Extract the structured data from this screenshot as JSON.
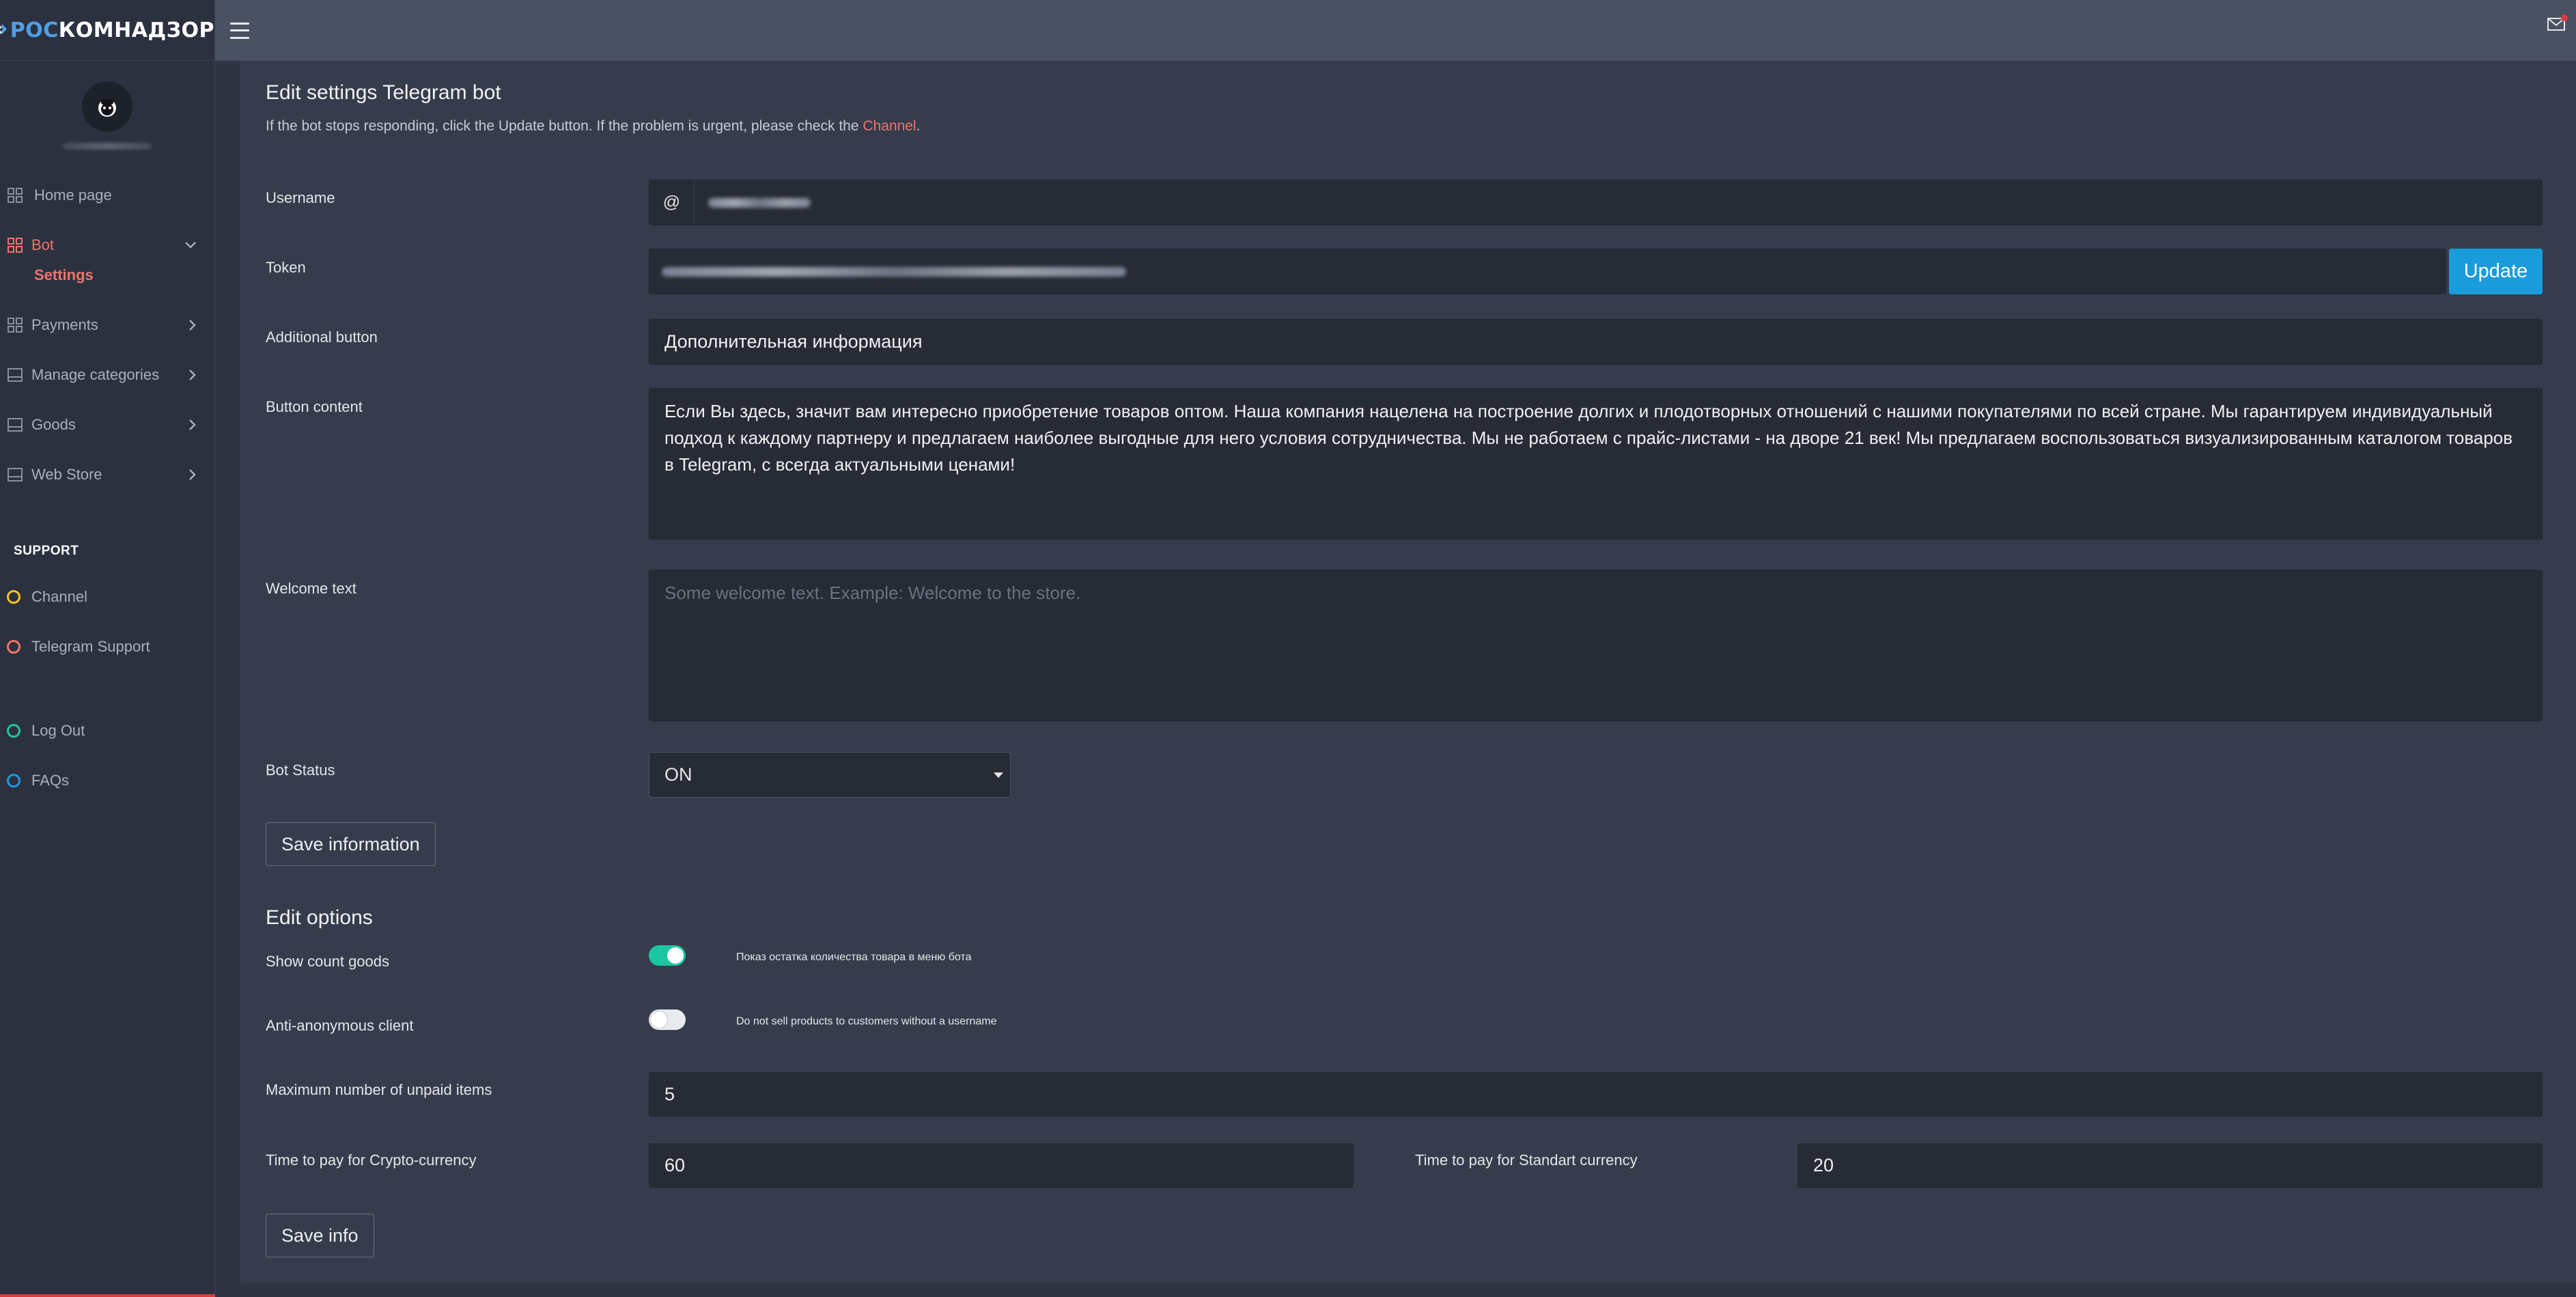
{
  "brand": {
    "prefix": "РОС",
    "rest": "КОМНАДЗОР"
  },
  "sidebar": {
    "items": [
      {
        "label": "Home page"
      },
      {
        "label": "Bot"
      },
      {
        "label": "Payments"
      },
      {
        "label": "Manage categories"
      },
      {
        "label": "Goods"
      },
      {
        "label": "Web Store"
      }
    ],
    "bot_subitem": "Settings",
    "support_title": "SUPPORT",
    "support_items": [
      {
        "label": "Channel",
        "color": "#f5c518"
      },
      {
        "label": "Telegram Support",
        "color": "#f07468"
      }
    ],
    "bottom_items": [
      {
        "label": "Log Out",
        "color": "#1cc6a0"
      },
      {
        "label": "FAQs",
        "color": "#1a9bdc"
      }
    ]
  },
  "panel": {
    "title": "Edit settings Telegram bot",
    "hint_prefix": "If the bot stops responding, click the Update button. If the problem is urgent, please check the ",
    "hint_link": "Channel",
    "hint_suffix": ".",
    "username_label": "Username",
    "username_prefix": "@",
    "token_label": "Token",
    "update_button": "Update",
    "additional_button_label": "Additional button",
    "additional_button_value": "Дополнительная информация",
    "button_content_label": "Button content",
    "button_content_value": "Если Вы здесь, значит вам интересно приобретение товаров оптом. Наша компания нацелена на построение долгих и плодотворных отношений с нашими покупателями по всей стране. Мы гарантируем индивидуальный подход к каждому партнеру и предлагаем наиболее выгодные для него условия сотрудничества. Мы не работаем с прайс-листами - на дворе 21 век! Мы предлагаем воспользоваться визуализированным  каталогом товаров в Telegram, с всегда актуальными ценами!",
    "welcome_text_label": "Welcome text",
    "welcome_text_placeholder": "Some welcome text. Example: Welcome to the store.",
    "bot_status_label": "Bot Status",
    "bot_status_value": "ON",
    "save_information_button": "Save information"
  },
  "options": {
    "title": "Edit options",
    "show_count_label": "Show count goods",
    "show_count_desc": "Показ остатка количества товара в меню бота",
    "show_count_on": true,
    "anti_anon_label": "Anti-anonymous client",
    "anti_anon_desc": "Do not sell products to customers without a username",
    "anti_anon_on": false,
    "max_unpaid_label": "Maximum number of unpaid items",
    "max_unpaid_value": "5",
    "crypto_time_label": "Time to pay for Crypto-currency",
    "crypto_time_value": "60",
    "standart_time_label": "Time to pay for Standart currency",
    "standart_time_value": "20",
    "save_info_button": "Save info"
  },
  "colors": {
    "accent_red": "#f07468",
    "accent_blue": "#1a9bdc",
    "toggle_on": "#1cc6a0"
  }
}
